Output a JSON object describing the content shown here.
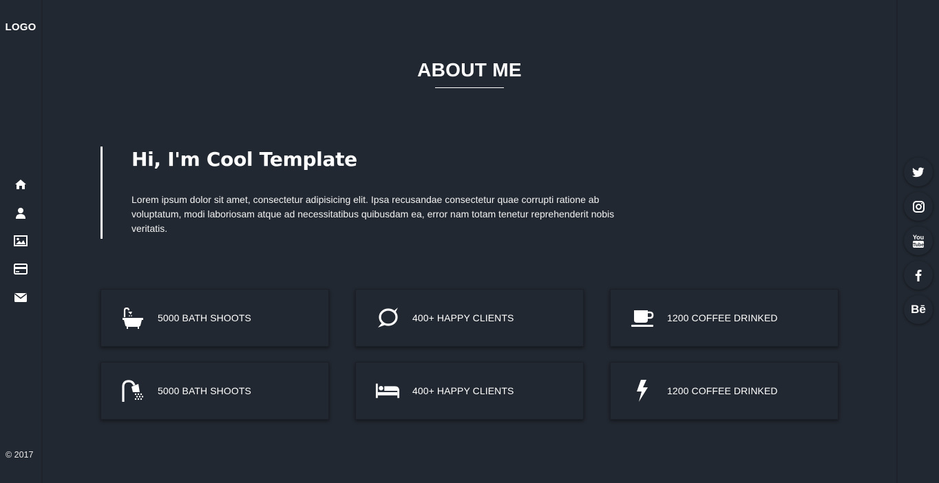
{
  "sidebar": {
    "logo": "LOGO",
    "nav": [
      {
        "icon": "home-icon"
      },
      {
        "icon": "user-icon"
      },
      {
        "icon": "image-icon"
      },
      {
        "icon": "card-icon"
      },
      {
        "icon": "envelope-icon"
      }
    ],
    "copyright": "© 2017"
  },
  "about": {
    "title": "ABOUT ME",
    "heading": "Hi, I'm Cool Template",
    "body": "Lorem ipsum dolor sit amet, consectetur adipisicing elit. Ipsa recusandae consectetur quae corrupti ratione ab voluptatum, modi laboriosam atque ad necessitatibus quibusdam ea, error nam totam tenetur reprehenderit nobis veritatis."
  },
  "stats": [
    {
      "icon": "bathtub-icon",
      "label": "5000 BATH SHOOTS"
    },
    {
      "icon": "chat-bubble-icon",
      "label": "400+ HAPPY CLIENTS"
    },
    {
      "icon": "coffee-cup-icon",
      "label": "1200 COFFEE DRINKED"
    },
    {
      "icon": "shower-icon",
      "label": "5000 BATH SHOOTS"
    },
    {
      "icon": "bed-icon",
      "label": "400+ HAPPY CLIENTS"
    },
    {
      "icon": "lightning-icon",
      "label": "1200 COFFEE DRINKED"
    }
  ],
  "social": [
    {
      "icon": "twitter-icon"
    },
    {
      "icon": "instagram-icon"
    },
    {
      "icon": "youtube-icon"
    },
    {
      "icon": "facebook-icon"
    },
    {
      "icon": "behance-icon",
      "text": "Bē"
    }
  ],
  "colors": {
    "background": "#222831",
    "text": "#ffffff"
  }
}
